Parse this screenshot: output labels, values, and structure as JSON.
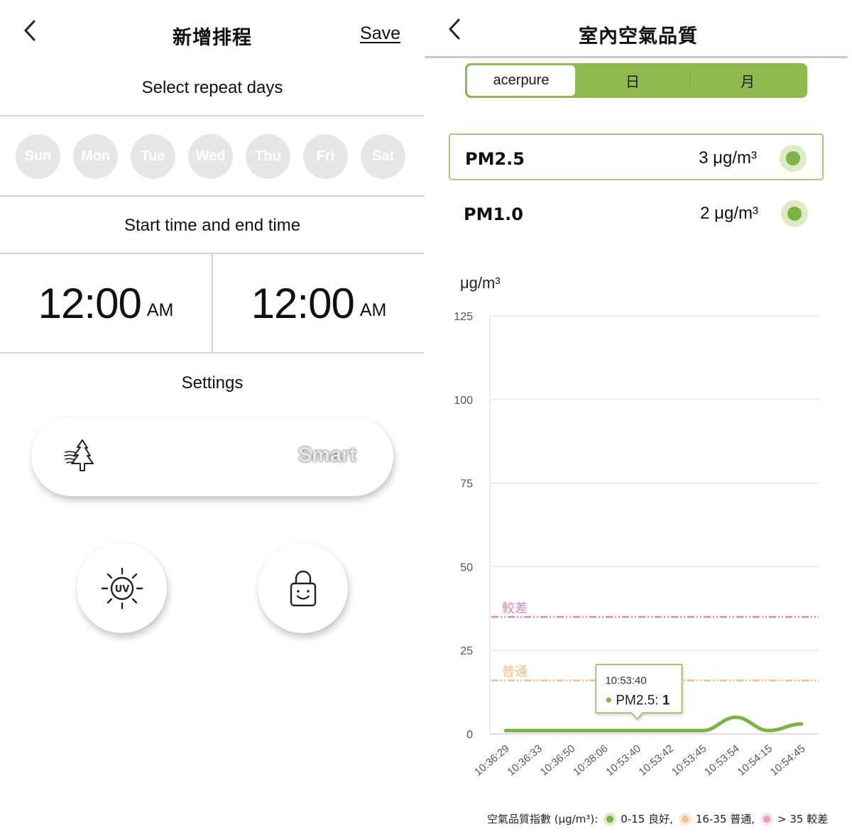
{
  "left": {
    "title": "新增排程",
    "save_label": "Save",
    "repeat_label": "Select repeat days",
    "days": [
      "Sun",
      "Mon",
      "Tue",
      "Wed",
      "Thu",
      "Fri",
      "Sat"
    ],
    "time_label": "Start time and end time",
    "start_time": {
      "time": "12:00",
      "period": "AM"
    },
    "end_time": {
      "time": "12:00",
      "period": "AM"
    },
    "settings_label": "Settings",
    "mode": {
      "icon": "tree-wind-icon",
      "label": "Smart"
    },
    "buttons": [
      {
        "icon": "uv-sun-icon",
        "label": "UV",
        "name": "uv"
      },
      {
        "icon": "child-lock-icon",
        "name": "child-lock"
      }
    ]
  },
  "right": {
    "title": "室內空氣品質",
    "tabs": [
      {
        "label": "acerpure",
        "active": true
      },
      {
        "label": "日",
        "active": false
      },
      {
        "label": "月",
        "active": false
      }
    ],
    "metrics": [
      {
        "name": "PM2.5",
        "value": "3 μg/m³",
        "status_color": "#7cb342",
        "selected": true
      },
      {
        "name": "PM1.0",
        "value": "2 μg/m³",
        "status_color": "#7cb342",
        "selected": false
      }
    ],
    "legend": {
      "prefix": "空氣品質指數 (μg/m³):",
      "items": [
        {
          "label": "0-15 良好,",
          "color": "#7cb342",
          "halo": "#dcebc6"
        },
        {
          "label": "16-35 普通,",
          "color": "#f2c48f",
          "halo": "#fcebd8"
        },
        {
          "label": "> 35 較差",
          "color": "#e79ac4",
          "halo": "#f8e0ee"
        }
      ]
    }
  },
  "chart_data": {
    "type": "line",
    "ylabel": "μg/m³",
    "xlabel": "",
    "ylim": [
      0,
      125
    ],
    "yticks": [
      0,
      25,
      50,
      75,
      100,
      125
    ],
    "grid": true,
    "categories": [
      "10:36:29",
      "10:36:33",
      "10:36:50",
      "10:38:06",
      "10:53:40",
      "10:53:42",
      "10:53:45",
      "10:53:54",
      "10:54:15",
      "10:54:45"
    ],
    "series": [
      {
        "name": "PM2.5",
        "color": "#7cb342",
        "values": [
          1,
          1,
          1,
          1,
          1,
          1,
          1,
          5,
          1,
          3
        ]
      }
    ],
    "thresholds": [
      {
        "label": "較差",
        "value": 35,
        "color": "#d88ab6"
      },
      {
        "label": "普通",
        "value": 16,
        "color": "#f0bd84"
      }
    ],
    "tooltip": {
      "title": "10:53:40",
      "series": "PM2.5",
      "value": "1",
      "category_index": 4
    }
  }
}
